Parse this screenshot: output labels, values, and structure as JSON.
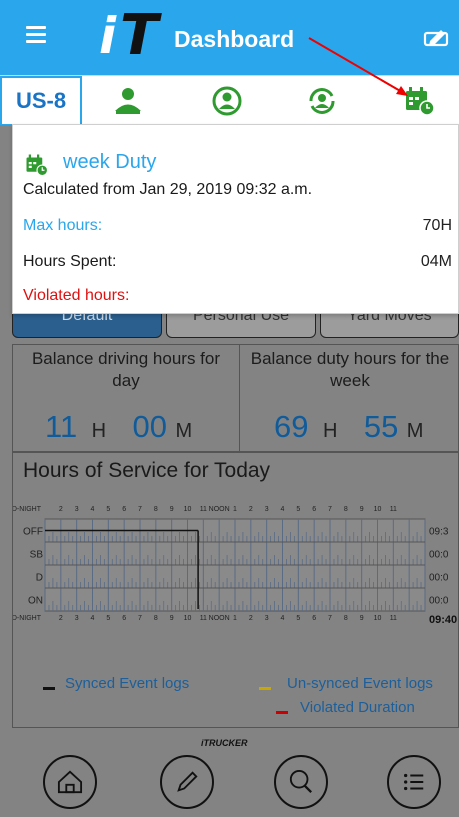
{
  "appbar": {
    "title": "Dashboard",
    "logo_i": "i",
    "logo_t": "T",
    "menu_icon": "hamburger-icon",
    "right_icon": "edit-certify-icon"
  },
  "toolbar": {
    "unit_label": "US-8",
    "icons": [
      "driver-icon",
      "driver-logs-icon",
      "co-driver-swap-icon",
      "calendar-clock-icon"
    ]
  },
  "popup": {
    "title": "week Duty",
    "subtitle": "Calculated from Jan 29, 2019 09:32 a.m.",
    "rows": [
      {
        "label": "Max hours:",
        "value": "70H",
        "color": "#2aa6ec"
      },
      {
        "label": "Hours Spent:",
        "value": "04M",
        "color": "#1a1a1a"
      },
      {
        "label": "Violated hours:",
        "value": "",
        "color": "#e01010"
      }
    ]
  },
  "tabs": [
    "Default",
    "Personal Use",
    "Yard Moves"
  ],
  "balance": {
    "driving": {
      "label_line1": "Balance driving hours for",
      "label_line2": "day",
      "hours": "11",
      "h_unit": "H",
      "minutes": "00",
      "m_unit": "M"
    },
    "duty": {
      "label_line1": "Balance duty hours for the",
      "label_line2": "week",
      "hours": "69",
      "h_unit": "H",
      "minutes": "55",
      "m_unit": "M"
    }
  },
  "hos": {
    "title": "Hours of Service for Today",
    "rows": [
      "OFF",
      "SB",
      "D",
      "ON"
    ],
    "row_totals": [
      "09:3",
      "00:0",
      "00:0",
      "00:0"
    ],
    "total": "09:40",
    "hour_labels": [
      "MID-NIGHT",
      "2",
      "3",
      "4",
      "5",
      "6",
      "7",
      "8",
      "9",
      "10",
      "11",
      "NOON",
      "1",
      "2",
      "3",
      "4",
      "5",
      "6",
      "7",
      "8",
      "9",
      "10",
      "11"
    ],
    "status_trace": {
      "status": "OFF",
      "start_hour": 0,
      "end_hour": 9.67
    }
  },
  "legend": {
    "synced": "Synced Event logs",
    "unsynced": "Un-synced Event logs",
    "violated": "Violated Duration"
  },
  "bottom": {
    "brand": "iTRUCKER",
    "nav_icons": [
      "home-icon",
      "pencil-icon",
      "search-icon",
      "list-icon"
    ]
  }
}
